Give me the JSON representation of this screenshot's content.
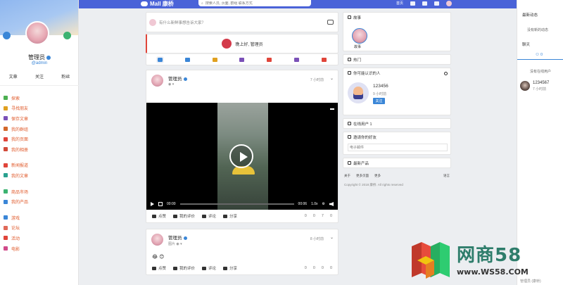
{
  "colors": {
    "topbar": "#4a63d8",
    "accent": "#3a86d7",
    "menu_text": "#e05a2b",
    "live_red": "#e0453a"
  },
  "header": {
    "logo_text": "Mall 康桥",
    "search_placeholder": "搜索人员, 页面, 群组 联系方式",
    "nav": [
      "首页",
      "",
      "",
      ""
    ]
  },
  "profile": {
    "name": "管理员",
    "handle": "@admin",
    "stats": [
      "文章",
      "关注",
      "粉丝"
    ]
  },
  "menu": {
    "items": [
      {
        "label": "探索",
        "icon": "grid-icon",
        "color": "#4caf50"
      },
      {
        "label": "寻找朋友",
        "icon": "pin-icon",
        "color": "#e0a020"
      },
      {
        "label": "保存文章",
        "icon": "bookmark-icon",
        "color": "#7b51b8"
      },
      {
        "label": "我的群组",
        "icon": "group-icon",
        "color": "#d3682b"
      },
      {
        "label": "我的页面",
        "icon": "flag-icon",
        "color": "#e0453a"
      },
      {
        "label": "我的相册",
        "icon": "photo-icon",
        "color": "#d14a3a"
      },
      {
        "label": "新闻报道",
        "icon": "news-icon",
        "color": "#e0453a"
      },
      {
        "label": "我的文章",
        "icon": "book-icon",
        "color": "#2aa18f"
      },
      {
        "label": "商品市场",
        "icon": "market-icon",
        "color": "#3cb371"
      },
      {
        "label": "我的产品",
        "icon": "box-icon",
        "color": "#3a86d7"
      },
      {
        "label": "游戏",
        "icon": "gamepad-icon",
        "color": "#3a86d7"
      },
      {
        "label": "论坛",
        "icon": "chat-icon",
        "color": "#e06a5a"
      },
      {
        "label": "活动",
        "icon": "calendar-icon",
        "color": "#e0453a"
      },
      {
        "label": "电影",
        "icon": "film-icon",
        "color": "#d14a8a"
      }
    ]
  },
  "composer": {
    "placeholder": "有什么新鲜事想告诉大家？",
    "greeting": "晚上好, 管理员"
  },
  "post1": {
    "author": "管理员",
    "time": "7 小时前",
    "video": {
      "current": "00:00",
      "duration": "00:06",
      "speed": "1.0x",
      "progress": 0.0
    },
    "actions": {
      "like": "点赞",
      "react": "我的评价",
      "comment": "评论",
      "share": "分享"
    },
    "counts": {
      "likes": "0",
      "reactions": "0",
      "views": "7",
      "comments": "0"
    }
  },
  "post2": {
    "author": "管理员",
    "sub": "图片",
    "time": "8 小时前",
    "emojis": "😂 😊",
    "actions": {
      "like": "点赞",
      "react": "我的评价",
      "comment": "评论",
      "share": "分享"
    },
    "counts": {
      "likes": "0",
      "reactions": "0",
      "views": "0",
      "comments": "0"
    }
  },
  "right": {
    "story_title": "故事",
    "story_label": "故事",
    "popular_title": "热门",
    "suggest_title": "你可能认识的人",
    "suggest_name": "123456",
    "suggest_time": "9 小时前",
    "suggest_button": "关注",
    "online_title": "在线用户 1",
    "invite_title": "邀请你的好友",
    "invite_placeholder": "电子邮件",
    "products_title": "最新产品",
    "footer_links": [
      "关于",
      "更多页面",
      "更多"
    ],
    "footer_lang": "语言",
    "copyright": "Copyright © 2018 康桥. All rights reserved"
  },
  "panel": {
    "title": "最新动态",
    "empty1": "没有新的动态",
    "title2": "聊天",
    "tab_count": "0",
    "empty2": "没有在线用户",
    "user_name": "1234567",
    "user_time": "7 小时前",
    "bottom_name": "管理员 (康桥)"
  },
  "watermark": {
    "brand": "网商58",
    "site": "www.WS58.COM"
  }
}
